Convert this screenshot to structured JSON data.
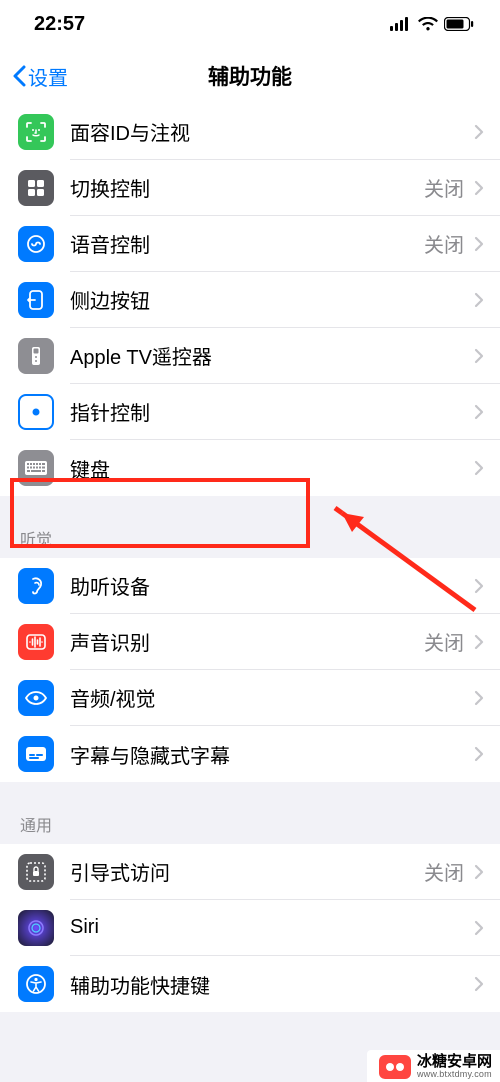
{
  "status": {
    "time": "22:57"
  },
  "nav": {
    "back": "设置",
    "title": "辅助功能"
  },
  "sections": {
    "s0": {
      "r0": {
        "label": "面容ID与注视",
        "value": ""
      },
      "r1": {
        "label": "切换控制",
        "value": "关闭"
      },
      "r2": {
        "label": "语音控制",
        "value": "关闭"
      },
      "r3": {
        "label": "侧边按钮",
        "value": ""
      },
      "r4": {
        "label": "Apple TV遥控器",
        "value": ""
      },
      "r5": {
        "label": "指针控制",
        "value": ""
      },
      "r6": {
        "label": "键盘",
        "value": ""
      }
    },
    "s1_header": "听觉",
    "s1": {
      "r0": {
        "label": "助听设备",
        "value": ""
      },
      "r1": {
        "label": "声音识别",
        "value": "关闭"
      },
      "r2": {
        "label": "音频/视觉",
        "value": ""
      },
      "r3": {
        "label": "字幕与隐藏式字幕",
        "value": ""
      }
    },
    "s2_header": "通用",
    "s2": {
      "r0": {
        "label": "引导式访问",
        "value": "关闭"
      },
      "r1": {
        "label": "Siri",
        "value": ""
      },
      "r2": {
        "label": "辅助功能快捷键",
        "value": ""
      }
    }
  },
  "watermark": {
    "name": "冰糖安卓网",
    "url": "www.btxtdmy.com"
  }
}
